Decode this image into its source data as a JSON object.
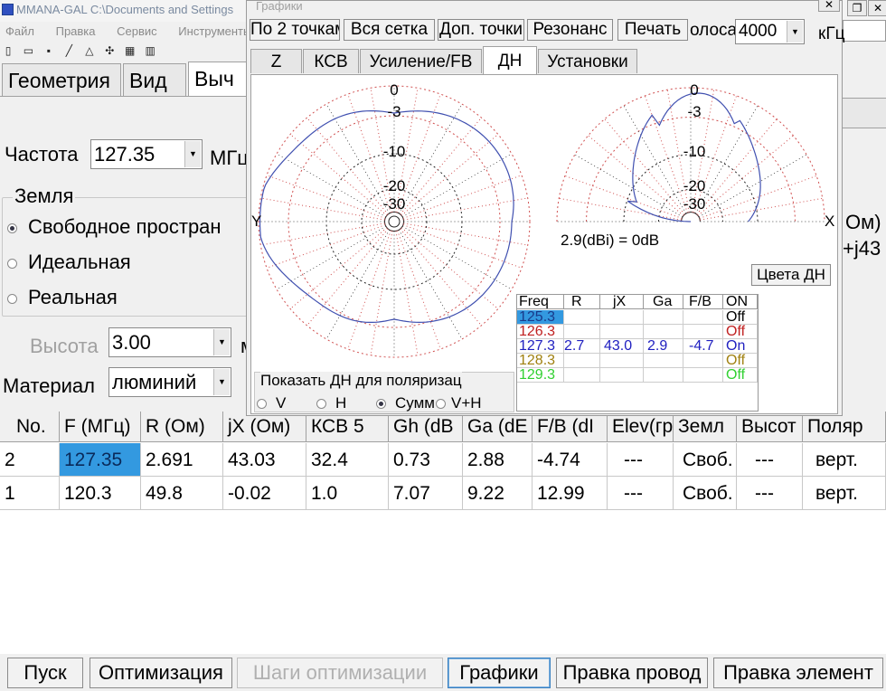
{
  "window": {
    "title": "MMANA-GAL C:\\Documents and Settings"
  },
  "menu": [
    "Файл",
    "Правка",
    "Сервис",
    "Инструменты"
  ],
  "toolbar_icons": [
    "new-icon",
    "open-icon",
    "save-icon",
    "line-icon",
    "triangle-icon",
    "wrench-icon",
    "calc-icon",
    "chart-icon"
  ],
  "tabs": [
    "Геометрия",
    "Вид",
    "Выч"
  ],
  "freq": {
    "label": "Частота",
    "value": "127.35",
    "unit": "МГц"
  },
  "ground": {
    "legend": "Земля",
    "options": [
      {
        "label": "Свободное простран",
        "selected": true
      },
      {
        "label": "Идеальная",
        "selected": false
      },
      {
        "label": "Реальная",
        "selected": false
      }
    ]
  },
  "height": {
    "label": "Высота",
    "value": "3.00",
    "unit": "м"
  },
  "material": {
    "label": "Материал",
    "value": "люминий"
  },
  "right_partial": {
    "r1": "Ом)",
    "r2": "+j43"
  },
  "results": {
    "headers": [
      "No.",
      "F (МГц)",
      "R (Ом)",
      "jX (Ом)",
      "КСВ 5",
      "Gh (dB",
      "Ga (dE",
      "F/B (dI",
      "Elev(гр",
      "Земл",
      "Высот",
      "Поляр"
    ],
    "rows": [
      [
        "2",
        "127.35",
        "2.691",
        "43.03",
        "32.4",
        "0.73",
        "2.88",
        "-4.74",
        "---",
        "Своб.",
        "---",
        "верт."
      ],
      [
        "1",
        "120.3",
        "49.8",
        "-0.02",
        "1.0",
        "7.07",
        "9.22",
        "12.99",
        "---",
        "Своб.",
        "---",
        "верт."
      ]
    ]
  },
  "buttons": {
    "start": "Пуск",
    "optimize": "Оптимизация",
    "opt_steps": "Шаги оптимизации",
    "graphs": "Графики",
    "edit_wire": "Правка провод",
    "edit_elem": "Правка элемент"
  },
  "graph_window": {
    "title": "Графики",
    "buttons": [
      "По 2 точкам",
      "Вся сетка",
      "Доп. точки",
      "Резонанс",
      "Печать"
    ],
    "band_label": "олоса",
    "band_value": "4000",
    "band_unit": "кГц",
    "tabs": [
      "Z",
      "КСВ",
      "Усиление/FB",
      "ДН",
      "Установки"
    ],
    "active_tab": "ДН",
    "polar_labels": [
      "0",
      "-3",
      "-10",
      "-20",
      "-30"
    ],
    "axis_y": "Y",
    "axis_x": "X",
    "gain_text": "2.9(dBi) = 0dB",
    "colors_button": "Цвета ДН",
    "pol_group": "Показать ДН для поляризац",
    "pol_options": [
      {
        "label": "V",
        "selected": false
      },
      {
        "label": "H",
        "selected": false
      },
      {
        "label": "Сумм",
        "selected": true
      },
      {
        "label": "V+H",
        "selected": false
      }
    ],
    "mini_headers": [
      "Freq",
      "R",
      "jX",
      "Ga",
      "F/B",
      "ON"
    ],
    "mini_rows": [
      {
        "freq": "125.3",
        "r": "",
        "jx": "",
        "ga": "",
        "fb": "",
        "on": "Off",
        "color": "#2060d0",
        "on_color": "#000000"
      },
      {
        "freq": "126.3",
        "r": "",
        "jx": "",
        "ga": "",
        "fb": "",
        "on": "Off",
        "color": "#c02020",
        "on_color": "#c02020"
      },
      {
        "freq": "127.3",
        "r": "2.7",
        "jx": "43.0",
        "ga": "2.9",
        "fb": "-4.7",
        "on": "On",
        "color": "#2020c0",
        "on_color": "#2020c0"
      },
      {
        "freq": "128.3",
        "r": "",
        "jx": "",
        "ga": "",
        "fb": "",
        "on": "Off",
        "color": "#a08010",
        "on_color": "#a08010"
      },
      {
        "freq": "129.3",
        "r": "",
        "jx": "",
        "ga": "",
        "fb": "",
        "on": "Off",
        "color": "#30d030",
        "on_color": "#30d030"
      }
    ]
  },
  "colors": {
    "selection": "#3399e0",
    "pattern": "#4050b0",
    "grid": "#d05050"
  }
}
